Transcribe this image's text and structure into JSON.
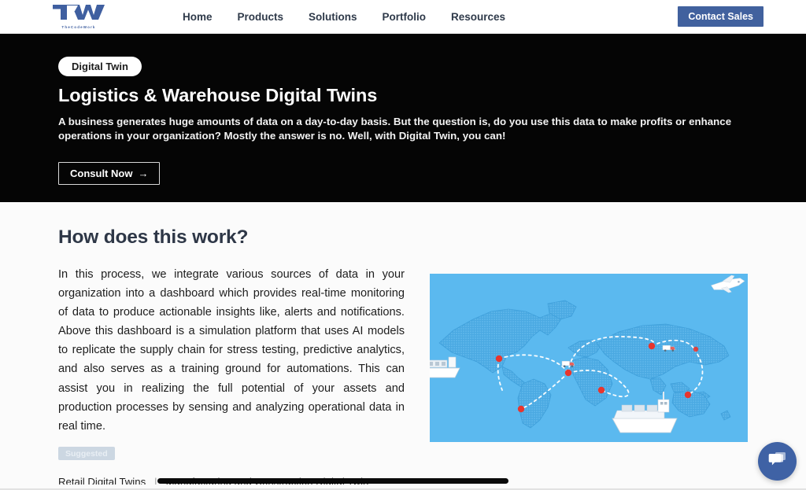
{
  "brand": {
    "logo_text": "TCW",
    "logo_wordmark": "TheCodeWork",
    "accent_blue": "#41619e",
    "hero_bg": "#050505",
    "map_bg": "#5bb9ef",
    "map_land": "#4aa9e2",
    "hub_dot": "#e8352e"
  },
  "navbar": {
    "links": [
      {
        "label": "Home"
      },
      {
        "label": "Products"
      },
      {
        "label": "Solutions"
      },
      {
        "label": "Portfolio"
      },
      {
        "label": "Resources"
      }
    ],
    "cta_label": "Contact Sales"
  },
  "hero": {
    "badge": "Digital Twin",
    "title": "Logistics & Warehouse Digital Twins",
    "description": "A business generates huge amounts of data on a day-to-day basis. But the question is, do you use this data to make profits or enhance operations in your organization? Mostly the answer is no. Well, with Digital Twin, you can!",
    "cta_label": "Consult Now",
    "cta_arrow": "→"
  },
  "main": {
    "section_title": "How does this work?",
    "body": "In this process, we integrate various sources of data in your organization into a dashboard which provides real-time monitoring of data to produce actionable insights like, alerts and notifications. Above this dashboard is a simulation platform that uses AI models to replicate the supply chain for stress testing, predictive analytics, and also serves as a training ground for automations. This can assist you in realizing the full potential of your assets and production processes by sensing and analyzing operational data in real time.",
    "figure": {
      "alt": "Isometric world map with global logistics routes, cargo ships, airplane and trucks",
      "hub_count": 7
    }
  },
  "suggested": {
    "badge": "Suggested",
    "links": [
      {
        "label": "Retail Digital Twins"
      },
      {
        "label": "Manufacturing and Construction Digital Twin"
      }
    ],
    "separator": "|"
  },
  "chat": {
    "icon": "chat-bubbles-icon"
  }
}
